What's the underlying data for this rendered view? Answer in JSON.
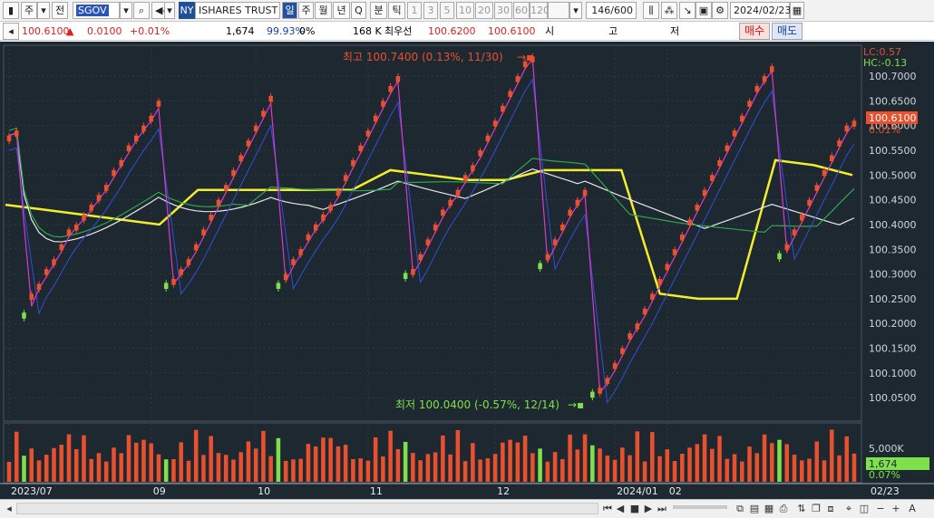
{
  "toolbar": {
    "market_label": "주",
    "type_label": "전",
    "symbol": "SGOV",
    "exchange_badge": "NY",
    "security_name": "ISHARES TRUST",
    "period_tabs": [
      "일",
      "주",
      "월",
      "년",
      "Q",
      "분",
      "틱"
    ],
    "minute_options": [
      "1",
      "3",
      "5",
      "10",
      "20",
      "30",
      "60",
      "120"
    ],
    "bar_count": "146",
    "bar_total": "/600",
    "date": "2024/02/23"
  },
  "info": {
    "price": "100.6100",
    "change_arrow": "▲",
    "change": "0.0100",
    "change_pct": "+0.01%",
    "volume": "1,674",
    "volume_ratio": "99.93%",
    "rate": "0%",
    "amount": "168 K",
    "best_bid_label": "최우선",
    "best_ask": "100.6200",
    "best_bid": "100.6100",
    "open_label": "시",
    "high_label": "고",
    "low_label": "저",
    "buy_label": "매수",
    "sell_label": "매도"
  },
  "chart": {
    "lc_label": "LC:0.57",
    "hc_label": "HC:-0.13",
    "last_price_label": "100.6100",
    "last_change_label": "0.01%",
    "volume_level_label": "5,000K",
    "last_volume_label": "1,674",
    "last_volume_pct": "0.07%",
    "high_annotation": "최고 100.7400 (0.13%, 11/30)",
    "low_annotation": "최저 100.0400 (-0.57%, 12/14)",
    "colors": {
      "background": "#1e2831",
      "up": "#e8502e",
      "down": "#7ee04a",
      "ma_yellow": "#f2ef2a",
      "ma_white": "#e8e8e8",
      "ma_green": "#2fa84a",
      "zigzag": "#d63ad0",
      "channel": "#2f4fd8"
    }
  },
  "chart_data": {
    "type": "candlestick",
    "title": "",
    "y_ticks": [
      "100.7000",
      "100.6500",
      "100.6000",
      "100.5500",
      "100.5000",
      "100.4500",
      "100.4000",
      "100.3500",
      "100.3000",
      "100.2500",
      "100.2000",
      "100.1500",
      "100.1000",
      "100.0500"
    ],
    "ylim": [
      100.01,
      100.755
    ],
    "x_ticks": [
      "2023/07",
      "09",
      "10",
      "11",
      "12",
      "2024/01",
      "02",
      "02/23"
    ],
    "volume_ticks": [
      "5,000K"
    ],
    "high": {
      "value": 100.74,
      "date": "11/30"
    },
    "low": {
      "value": 100.04,
      "date": "12/14"
    },
    "last": {
      "price": 100.61,
      "volume": 1674
    },
    "series": [
      {
        "name": "close",
        "values": [
          100.58,
          100.59,
          100.21,
          100.26,
          100.28,
          100.31,
          100.33,
          100.36,
          100.39,
          100.4,
          100.42,
          100.44,
          100.46,
          100.48,
          100.51,
          100.53,
          100.56,
          100.58,
          100.6,
          100.62,
          100.65,
          100.27,
          100.29,
          100.31,
          100.33,
          100.36,
          100.39,
          100.42,
          100.45,
          100.48,
          100.51,
          100.54,
          100.57,
          100.6,
          100.63,
          100.66,
          100.27,
          100.3,
          100.33,
          100.35,
          100.38,
          100.4,
          100.42,
          100.44,
          100.47,
          100.5,
          100.53,
          100.56,
          100.59,
          100.62,
          100.65,
          100.68,
          100.7,
          100.29,
          100.31,
          100.34,
          100.37,
          100.4,
          100.43,
          100.45,
          100.47,
          100.5,
          100.52,
          100.55,
          100.58,
          100.61,
          100.64,
          100.67,
          100.7,
          100.73,
          100.74,
          100.31,
          100.34,
          100.37,
          100.4,
          100.43,
          100.45,
          100.47,
          100.05,
          100.07,
          100.09,
          100.12,
          100.15,
          100.18,
          100.2,
          100.23,
          100.26,
          100.29,
          100.32,
          100.35,
          100.38,
          100.41,
          100.44,
          100.47,
          100.5,
          100.53,
          100.56,
          100.59,
          100.62,
          100.65,
          100.68,
          100.7,
          100.72,
          100.33,
          100.36,
          100.39,
          100.42,
          100.45,
          100.48,
          100.51,
          100.54,
          100.57,
          100.6,
          100.61
        ]
      },
      {
        "name": "MA-long",
        "values": [
          100.44,
          100.43,
          100.42,
          100.41,
          100.4,
          100.47,
          100.47,
          100.47,
          100.47,
          100.47,
          100.51,
          100.5,
          100.49,
          100.49,
          100.51,
          100.51,
          100.51,
          100.26,
          100.25,
          100.25,
          100.53,
          100.52,
          100.5
        ]
      }
    ]
  }
}
